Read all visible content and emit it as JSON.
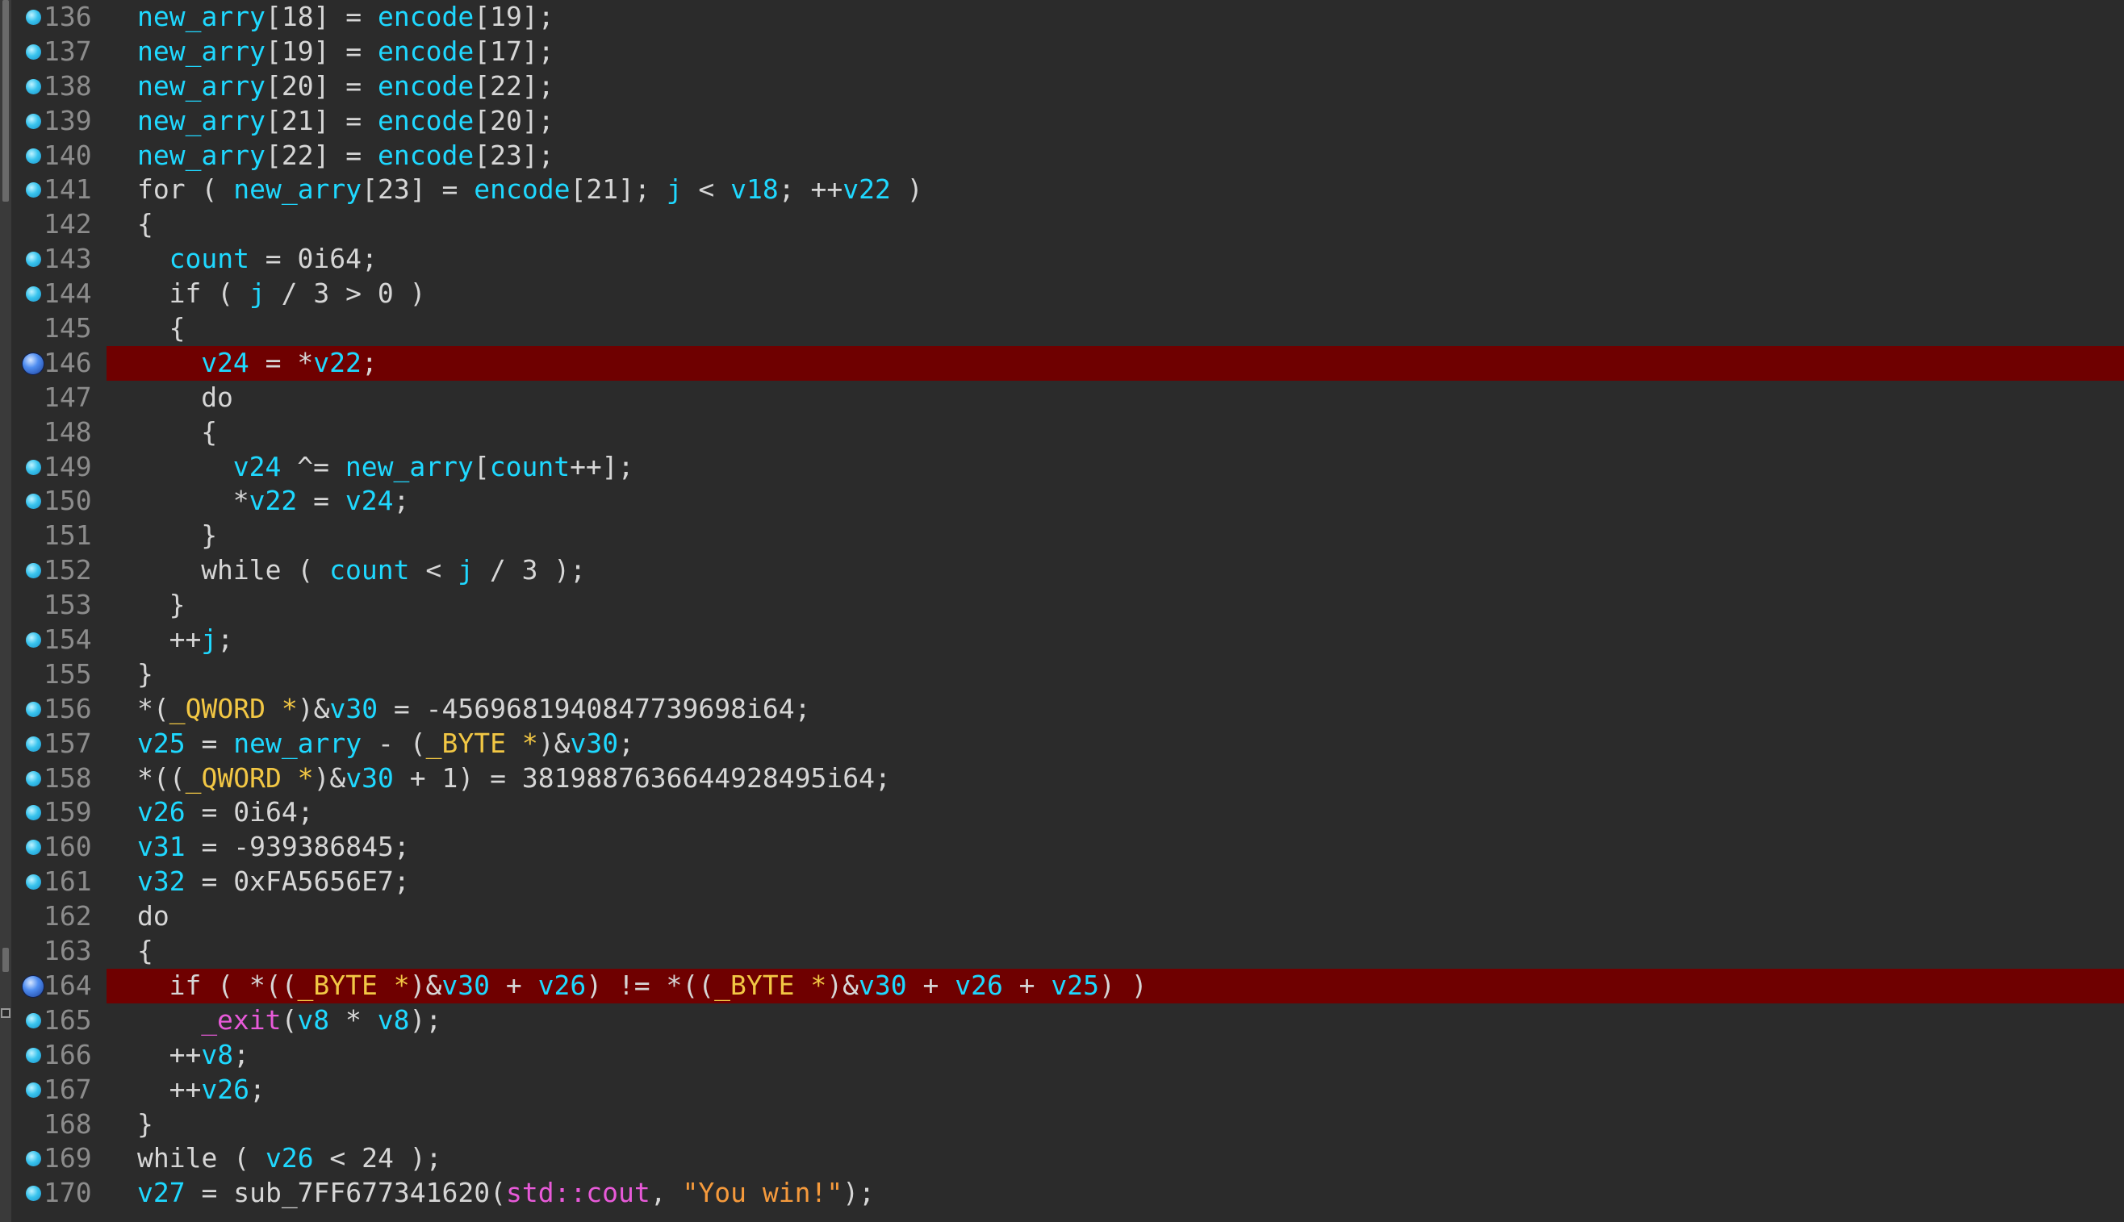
{
  "colors": {
    "background": "#2b2b2b",
    "highlight": "#6f0000",
    "line_number": "#8c8c8c",
    "plain": "#d6d6d6",
    "variable": "#1fd8ff",
    "type": "#f2c744",
    "function": "#e85ad9",
    "string": "#f59a3c"
  },
  "code": {
    "lines": [
      {
        "num": "136",
        "bp": "normal",
        "hl": false,
        "indent": 0,
        "tokens": [
          [
            "v",
            "new_arry"
          ],
          [
            "p",
            "[18] = "
          ],
          [
            "v",
            "encode"
          ],
          [
            "p",
            "[19];"
          ]
        ]
      },
      {
        "num": "137",
        "bp": "normal",
        "hl": false,
        "indent": 0,
        "tokens": [
          [
            "v",
            "new_arry"
          ],
          [
            "p",
            "[19] = "
          ],
          [
            "v",
            "encode"
          ],
          [
            "p",
            "[17];"
          ]
        ]
      },
      {
        "num": "138",
        "bp": "normal",
        "hl": false,
        "indent": 0,
        "tokens": [
          [
            "v",
            "new_arry"
          ],
          [
            "p",
            "[20] = "
          ],
          [
            "v",
            "encode"
          ],
          [
            "p",
            "[22];"
          ]
        ]
      },
      {
        "num": "139",
        "bp": "normal",
        "hl": false,
        "indent": 0,
        "tokens": [
          [
            "v",
            "new_arry"
          ],
          [
            "p",
            "[21] = "
          ],
          [
            "v",
            "encode"
          ],
          [
            "p",
            "[20];"
          ]
        ]
      },
      {
        "num": "140",
        "bp": "normal",
        "hl": false,
        "indent": 0,
        "tokens": [
          [
            "v",
            "new_arry"
          ],
          [
            "p",
            "[22] = "
          ],
          [
            "v",
            "encode"
          ],
          [
            "p",
            "[23];"
          ]
        ]
      },
      {
        "num": "141",
        "bp": "normal",
        "hl": false,
        "indent": 0,
        "tokens": [
          [
            "p",
            "for ( "
          ],
          [
            "v",
            "new_arry"
          ],
          [
            "p",
            "[23] = "
          ],
          [
            "v",
            "encode"
          ],
          [
            "p",
            "[21]; "
          ],
          [
            "v",
            "j"
          ],
          [
            "p",
            " < "
          ],
          [
            "v",
            "v18"
          ],
          [
            "p",
            "; ++"
          ],
          [
            "v",
            "v22"
          ],
          [
            "p",
            " )"
          ]
        ]
      },
      {
        "num": "142",
        "bp": "none",
        "hl": false,
        "indent": 0,
        "tokens": [
          [
            "p",
            "{"
          ]
        ]
      },
      {
        "num": "143",
        "bp": "normal",
        "hl": false,
        "indent": 1,
        "tokens": [
          [
            "v",
            "count"
          ],
          [
            "p",
            " = 0i64;"
          ]
        ]
      },
      {
        "num": "144",
        "bp": "normal",
        "hl": false,
        "indent": 1,
        "tokens": [
          [
            "p",
            "if ( "
          ],
          [
            "v",
            "j"
          ],
          [
            "p",
            " / 3 > 0 )"
          ]
        ]
      },
      {
        "num": "145",
        "bp": "none",
        "hl": false,
        "indent": 1,
        "tokens": [
          [
            "p",
            "{"
          ]
        ]
      },
      {
        "num": "146",
        "bp": "active",
        "hl": true,
        "indent": 2,
        "tokens": [
          [
            "v",
            "v24"
          ],
          [
            "p",
            " = *"
          ],
          [
            "v",
            "v22"
          ],
          [
            "p",
            ";"
          ]
        ]
      },
      {
        "num": "147",
        "bp": "none",
        "hl": false,
        "indent": 2,
        "tokens": [
          [
            "p",
            "do"
          ]
        ]
      },
      {
        "num": "148",
        "bp": "none",
        "hl": false,
        "indent": 2,
        "tokens": [
          [
            "p",
            "{"
          ]
        ]
      },
      {
        "num": "149",
        "bp": "normal",
        "hl": false,
        "indent": 3,
        "tokens": [
          [
            "v",
            "v24"
          ],
          [
            "p",
            " ^= "
          ],
          [
            "v",
            "new_arry"
          ],
          [
            "p",
            "["
          ],
          [
            "v",
            "count"
          ],
          [
            "p",
            "++];"
          ]
        ]
      },
      {
        "num": "150",
        "bp": "normal",
        "hl": false,
        "indent": 3,
        "tokens": [
          [
            "p",
            "*"
          ],
          [
            "v",
            "v22"
          ],
          [
            "p",
            " = "
          ],
          [
            "v",
            "v24"
          ],
          [
            "p",
            ";"
          ]
        ]
      },
      {
        "num": "151",
        "bp": "none",
        "hl": false,
        "indent": 2,
        "tokens": [
          [
            "p",
            "}"
          ]
        ]
      },
      {
        "num": "152",
        "bp": "normal",
        "hl": false,
        "indent": 2,
        "tokens": [
          [
            "p",
            "while ( "
          ],
          [
            "v",
            "count"
          ],
          [
            "p",
            " < "
          ],
          [
            "v",
            "j"
          ],
          [
            "p",
            " / 3 );"
          ]
        ]
      },
      {
        "num": "153",
        "bp": "none",
        "hl": false,
        "indent": 1,
        "tokens": [
          [
            "p",
            "}"
          ]
        ]
      },
      {
        "num": "154",
        "bp": "normal",
        "hl": false,
        "indent": 1,
        "tokens": [
          [
            "p",
            "++"
          ],
          [
            "v",
            "j"
          ],
          [
            "p",
            ";"
          ]
        ]
      },
      {
        "num": "155",
        "bp": "none",
        "hl": false,
        "indent": 0,
        "tokens": [
          [
            "p",
            "}"
          ]
        ]
      },
      {
        "num": "156",
        "bp": "normal",
        "hl": false,
        "indent": 0,
        "tokens": [
          [
            "p",
            "*("
          ],
          [
            "t",
            "_QWORD *"
          ],
          [
            "p",
            ")&"
          ],
          [
            "v",
            "v30"
          ],
          [
            "p",
            " = -4569681940847739698i64;"
          ]
        ]
      },
      {
        "num": "157",
        "bp": "normal",
        "hl": false,
        "indent": 0,
        "tokens": [
          [
            "v",
            "v25"
          ],
          [
            "p",
            " = "
          ],
          [
            "v",
            "new_arry"
          ],
          [
            "p",
            " - ("
          ],
          [
            "t",
            "_BYTE *"
          ],
          [
            "p",
            ")&"
          ],
          [
            "v",
            "v30"
          ],
          [
            "p",
            ";"
          ]
        ]
      },
      {
        "num": "158",
        "bp": "normal",
        "hl": false,
        "indent": 0,
        "tokens": [
          [
            "p",
            "*(("
          ],
          [
            "t",
            "_QWORD *"
          ],
          [
            "p",
            ")&"
          ],
          [
            "v",
            "v30"
          ],
          [
            "p",
            " + 1) = 3819887636644928495i64;"
          ]
        ]
      },
      {
        "num": "159",
        "bp": "normal",
        "hl": false,
        "indent": 0,
        "tokens": [
          [
            "v",
            "v26"
          ],
          [
            "p",
            " = 0i64;"
          ]
        ]
      },
      {
        "num": "160",
        "bp": "normal",
        "hl": false,
        "indent": 0,
        "tokens": [
          [
            "v",
            "v31"
          ],
          [
            "p",
            " = -939386845;"
          ]
        ]
      },
      {
        "num": "161",
        "bp": "normal",
        "hl": false,
        "indent": 0,
        "tokens": [
          [
            "v",
            "v32"
          ],
          [
            "p",
            " = 0xFA5656E7;"
          ]
        ]
      },
      {
        "num": "162",
        "bp": "none",
        "hl": false,
        "indent": 0,
        "tokens": [
          [
            "p",
            "do"
          ]
        ]
      },
      {
        "num": "163",
        "bp": "none",
        "hl": false,
        "indent": 0,
        "tokens": [
          [
            "p",
            "{"
          ]
        ]
      },
      {
        "num": "164",
        "bp": "active",
        "hl": true,
        "indent": 1,
        "tokens": [
          [
            "p",
            "if ( *(("
          ],
          [
            "t",
            "_BYTE *"
          ],
          [
            "p",
            ")&"
          ],
          [
            "v",
            "v30"
          ],
          [
            "p",
            " + "
          ],
          [
            "v",
            "v26"
          ],
          [
            "p",
            ") != *(("
          ],
          [
            "t",
            "_BYTE *"
          ],
          [
            "p",
            ")&"
          ],
          [
            "v",
            "v30"
          ],
          [
            "p",
            " + "
          ],
          [
            "v",
            "v26"
          ],
          [
            "p",
            " + "
          ],
          [
            "v",
            "v25"
          ],
          [
            "p",
            ") )"
          ]
        ]
      },
      {
        "num": "165",
        "bp": "normal",
        "hl": false,
        "indent": 2,
        "tokens": [
          [
            "f",
            "_exit"
          ],
          [
            "p",
            "("
          ],
          [
            "v",
            "v8"
          ],
          [
            "p",
            " * "
          ],
          [
            "v",
            "v8"
          ],
          [
            "p",
            ");"
          ]
        ]
      },
      {
        "num": "166",
        "bp": "normal",
        "hl": false,
        "indent": 1,
        "tokens": [
          [
            "p",
            "++"
          ],
          [
            "v",
            "v8"
          ],
          [
            "p",
            ";"
          ]
        ]
      },
      {
        "num": "167",
        "bp": "normal",
        "hl": false,
        "indent": 1,
        "tokens": [
          [
            "p",
            "++"
          ],
          [
            "v",
            "v26"
          ],
          [
            "p",
            ";"
          ]
        ]
      },
      {
        "num": "168",
        "bp": "none",
        "hl": false,
        "indent": 0,
        "tokens": [
          [
            "p",
            "}"
          ]
        ]
      },
      {
        "num": "169",
        "bp": "normal",
        "hl": false,
        "indent": 0,
        "tokens": [
          [
            "p",
            "while ( "
          ],
          [
            "v",
            "v26"
          ],
          [
            "p",
            " < 24 );"
          ]
        ]
      },
      {
        "num": "170",
        "bp": "normal",
        "hl": false,
        "indent": 0,
        "tokens": [
          [
            "v",
            "v27"
          ],
          [
            "p",
            " = sub_7FF677341620("
          ],
          [
            "f",
            "std::cout"
          ],
          [
            "p",
            ", "
          ],
          [
            "s",
            "\"You win!\""
          ],
          [
            "p",
            ");"
          ]
        ]
      }
    ]
  }
}
